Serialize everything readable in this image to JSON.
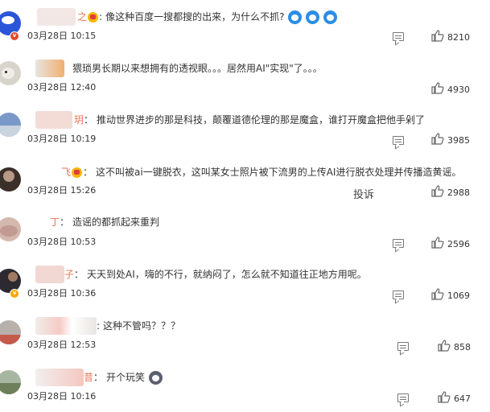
{
  "comments": [
    {
      "text": "像这种百度一搜都搜的出来，为什么不抓?",
      "time": "03月28日 10:15",
      "likes": "8210"
    },
    {
      "text": "猥琐男长期以来想拥有的透视眼。。。居然用AI\"实现\"了。。。",
      "time": "03月28日 12:40",
      "likes": "4930"
    },
    {
      "name_tail": "玥",
      "text": "推动世界进步的那是科技，颠覆道德伦理的那是魔盒，谁打开魔盒把他手剁了",
      "time": "03月28日 10:19",
      "likes": "3985"
    },
    {
      "name_tail": "飞",
      "text": "这不叫被ai一键脱衣，这叫某女士照片被下流男的上传AI进行脱衣处理并传播造黄谣。",
      "time": "03月28日 15:26",
      "likes": "2988",
      "report": "投诉"
    },
    {
      "name_tail": "丁",
      "text": "造谣的都抓起来重判",
      "time": "03月28日 10:53",
      "likes": "2596"
    },
    {
      "name_tail": "子",
      "text": "天天到处AI，嗨的不行，就纳闷了，怎么就不知道往正地方用呢。",
      "time": "03月28日 10:36",
      "likes": "1069"
    },
    {
      "text": "这种不管吗？？？",
      "time": "03月28日 12:53",
      "likes": "858"
    },
    {
      "name_tail": "昔",
      "text": "开个玩笑",
      "time": "03月28日 10:16",
      "likes": "647"
    }
  ]
}
